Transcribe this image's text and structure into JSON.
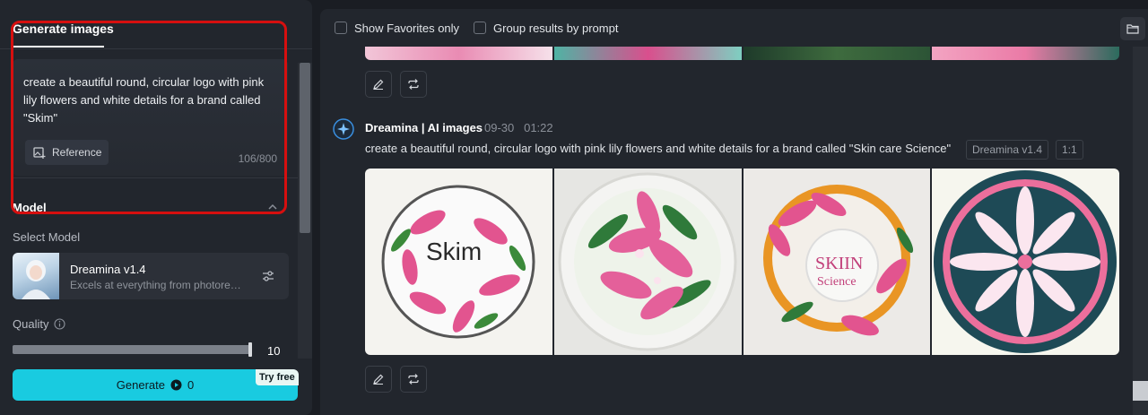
{
  "left_panel": {
    "tab_label": "Generate images",
    "prompt_text": "create a beautiful round, circular logo with pink lily flowers and white details for a brand called \"Skim\"",
    "reference_label": "Reference",
    "char_counter": "106/800",
    "model_section_title": "Model",
    "select_model_label": "Select Model",
    "model_name": "Dreamina v1.4",
    "model_description": "Excels at everything from photorealism...",
    "quality_label": "Quality",
    "quality_value": "10",
    "quality_fraction": 1.0,
    "generate_label": "Generate",
    "generate_cost": "0",
    "try_free_label": "Try free"
  },
  "toolbar": {
    "show_favorites_label": "Show Favorites only",
    "group_by_prompt_label": "Group results by prompt"
  },
  "result": {
    "bot_name": "Dreamina | AI images",
    "date": "09-30",
    "time": "01:22",
    "prompt": "create a beautiful round, circular logo with pink lily flowers and white details for a brand called \"Skin care Science\"",
    "model_tag": "Dreamina v1.4",
    "ratio_tag": "1:1",
    "image_texts": [
      "Skim",
      "SKIIN",
      "Science"
    ]
  },
  "colors": {
    "accent": "#19cbe0",
    "highlight_border": "#d60f0f",
    "lily_pink": "#e2548f"
  }
}
